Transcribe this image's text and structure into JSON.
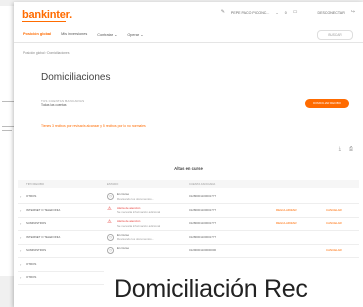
{
  "header": {
    "logo": "bankinter.",
    "user_name": "PEPE PACO PICONC...",
    "user_badge": "0",
    "disconnect": "DESCONECTAR",
    "search": "BUSCAR"
  },
  "nav": {
    "items": [
      "Posición global",
      "Mis inversiones",
      "Contratar",
      "Operar"
    ]
  },
  "breadcrumb": "Posición global  ›  Domiciliaciones",
  "page": {
    "title": "Domiciliaciones",
    "account_label": "TUS CUENTAS BANCARIAS",
    "account_value": "Todas las cuentas",
    "new_button": "DOMICILIAR RECIBO",
    "notice": "Tienes 3 recibos por revisar/a alcanzar y 5 recibos por lo no normales"
  },
  "table": {
    "title": "Altas en curse",
    "headers": [
      "TIPO RECIBO",
      "ESTADO",
      "CUENTA ASOCIADA"
    ],
    "rows": [
      {
        "type": "OTROS",
        "status": "En Curso",
        "detail": "Revisando los documentos...",
        "account": "01280001100001777",
        "act1": "",
        "act2": "",
        "warn": false
      },
      {
        "type": "INTERNET O TELEFONIA",
        "status": "Alerta de atención",
        "detail": "Se necesita información adicional",
        "account": "01280001100001777",
        "act1": "REGULARIZAR",
        "act2": "CANCELAR",
        "warn": true
      },
      {
        "type": "SUMINISTROS",
        "status": "Alerta de atención",
        "detail": "Se necesita información adicional",
        "account": "01280001100001777",
        "act1": "REGULARIZAR",
        "act2": "CANCELAR",
        "warn": true
      },
      {
        "type": "INTERNET O TELEFONIA",
        "status": "En Curso",
        "detail": "Revisando los documentos...",
        "account": "01280001100001777",
        "act1": "",
        "act2": "",
        "warn": false
      },
      {
        "type": "SUMINISTROS",
        "status": "En Curso",
        "detail": "",
        "account": "01290001100000000",
        "act1": "",
        "act2": "CANCELAR",
        "warn": false
      },
      {
        "type": "OTROS",
        "status": "",
        "detail": "",
        "account": "",
        "act1": "",
        "act2": "",
        "warn": false
      },
      {
        "type": "OTROS",
        "status": "",
        "detail": "",
        "account": "",
        "act1": "",
        "act2": "",
        "warn": false
      }
    ]
  },
  "caption": "Domiciliación Rec",
  "icons": {
    "edit": "pencil-icon",
    "notifications": "bell-icon",
    "chat": "chat-icon",
    "logout": "logout-icon",
    "download": "download-icon",
    "print": "print-icon"
  },
  "colors": {
    "accent": "#ff6b00",
    "alert": "#e53935"
  }
}
